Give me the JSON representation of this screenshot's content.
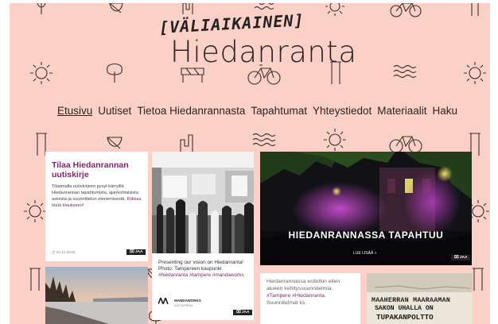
{
  "logo": {
    "tag": "[VÄLIAIKAINEN]",
    "name": "Hiedanranta"
  },
  "nav": {
    "items": [
      "Etusivu",
      "Uutiset",
      "Tietoa Hiedanrannasta",
      "Tapahtumat",
      "Yhteystiedot",
      "Materiaalit",
      "Haku"
    ],
    "active": "Etusivu"
  },
  "cards": {
    "newsletter": {
      "title": "Tilaa Hiedanrannan uutiskirje",
      "body": "Tilaamalla uutiskirjeen pysyt kärryillä Hiedanrannan tapahtumista, ajankohtaisista asioista ja suunnittelun etenemisestä.",
      "link": "Klikkaa tästä tilaukseen!",
      "date": "10.11.2016",
      "share": "JAA"
    },
    "instagram": {
      "caption": "Presenting our vision on Hiedanranta! Photo: Tampereen kaupunki",
      "tags": "#hiedanranta #tampere #mandaworks",
      "source": "MANDAWORKS",
      "network": "INSTAGRAM",
      "share": "JAA"
    },
    "event": {
      "headline": "HIEDANRANNASSA TAPAHTUU",
      "more": "LUE LISÄÄ »",
      "share": "JAA"
    },
    "twitter": {
      "text": "Hiedanrannassa esiteltiin ellen alueen kehityssuunnitelmia.",
      "tags": "#Tampere #Hiedanranta.",
      "tail": "Suunnitelmat ks."
    },
    "sign": {
      "line1": "MAAHERRAN MAARAAMAN",
      "line2": "SAKON UHALLA ON",
      "line3": "TUPAKANPOLTTO"
    }
  },
  "colors": {
    "background": "#fbd0c7",
    "accent": "#7a2a6c",
    "text": "#2a2424"
  }
}
